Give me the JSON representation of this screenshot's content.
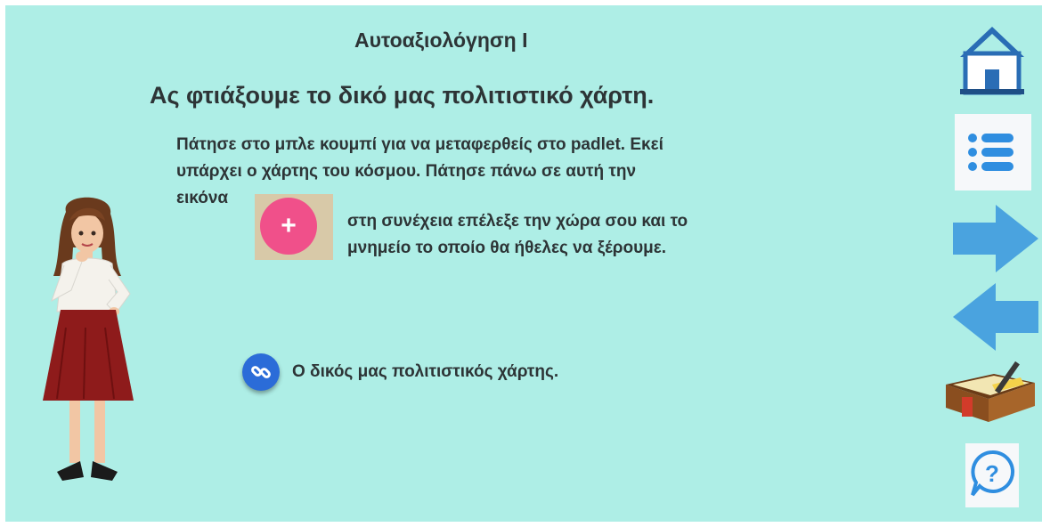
{
  "page": {
    "subtitle": "Αυτοαξιολόγηση Ι",
    "title": "Ας φτιάξουμε το δικό μας πολιτιστικό χάρτη."
  },
  "instructions": {
    "line1": "Πάτησε στο μπλε κουμπί για να μεταφερθείς στο padlet.  Εκεί",
    "line2": "υπάρχει ο χάρτης του κόσμου.  Πάτησε πάνω σε αυτή την",
    "line3": "εικόνα",
    "line4": "στη συνέχεια επέλεξε την χώρα σου και το",
    "line5": "μνημείο το οποίο θα ήθελες να ξέρουμε."
  },
  "padlet_plus": {
    "symbol": "+"
  },
  "link": {
    "label": "Ο δικός μας πολιτιστικός χάρτης."
  },
  "nav": {
    "items": [
      "home-icon",
      "menu-list-icon",
      "arrow-right-icon",
      "arrow-left-icon",
      "notebook-icon",
      "help-icon"
    ]
  },
  "colors": {
    "background": "#aeeee6",
    "text": "#2d3436",
    "link_button": "#2b6cd8",
    "plus_button": "#f0508a",
    "arrow": "#4aa3df",
    "home": "#2a6db5"
  }
}
